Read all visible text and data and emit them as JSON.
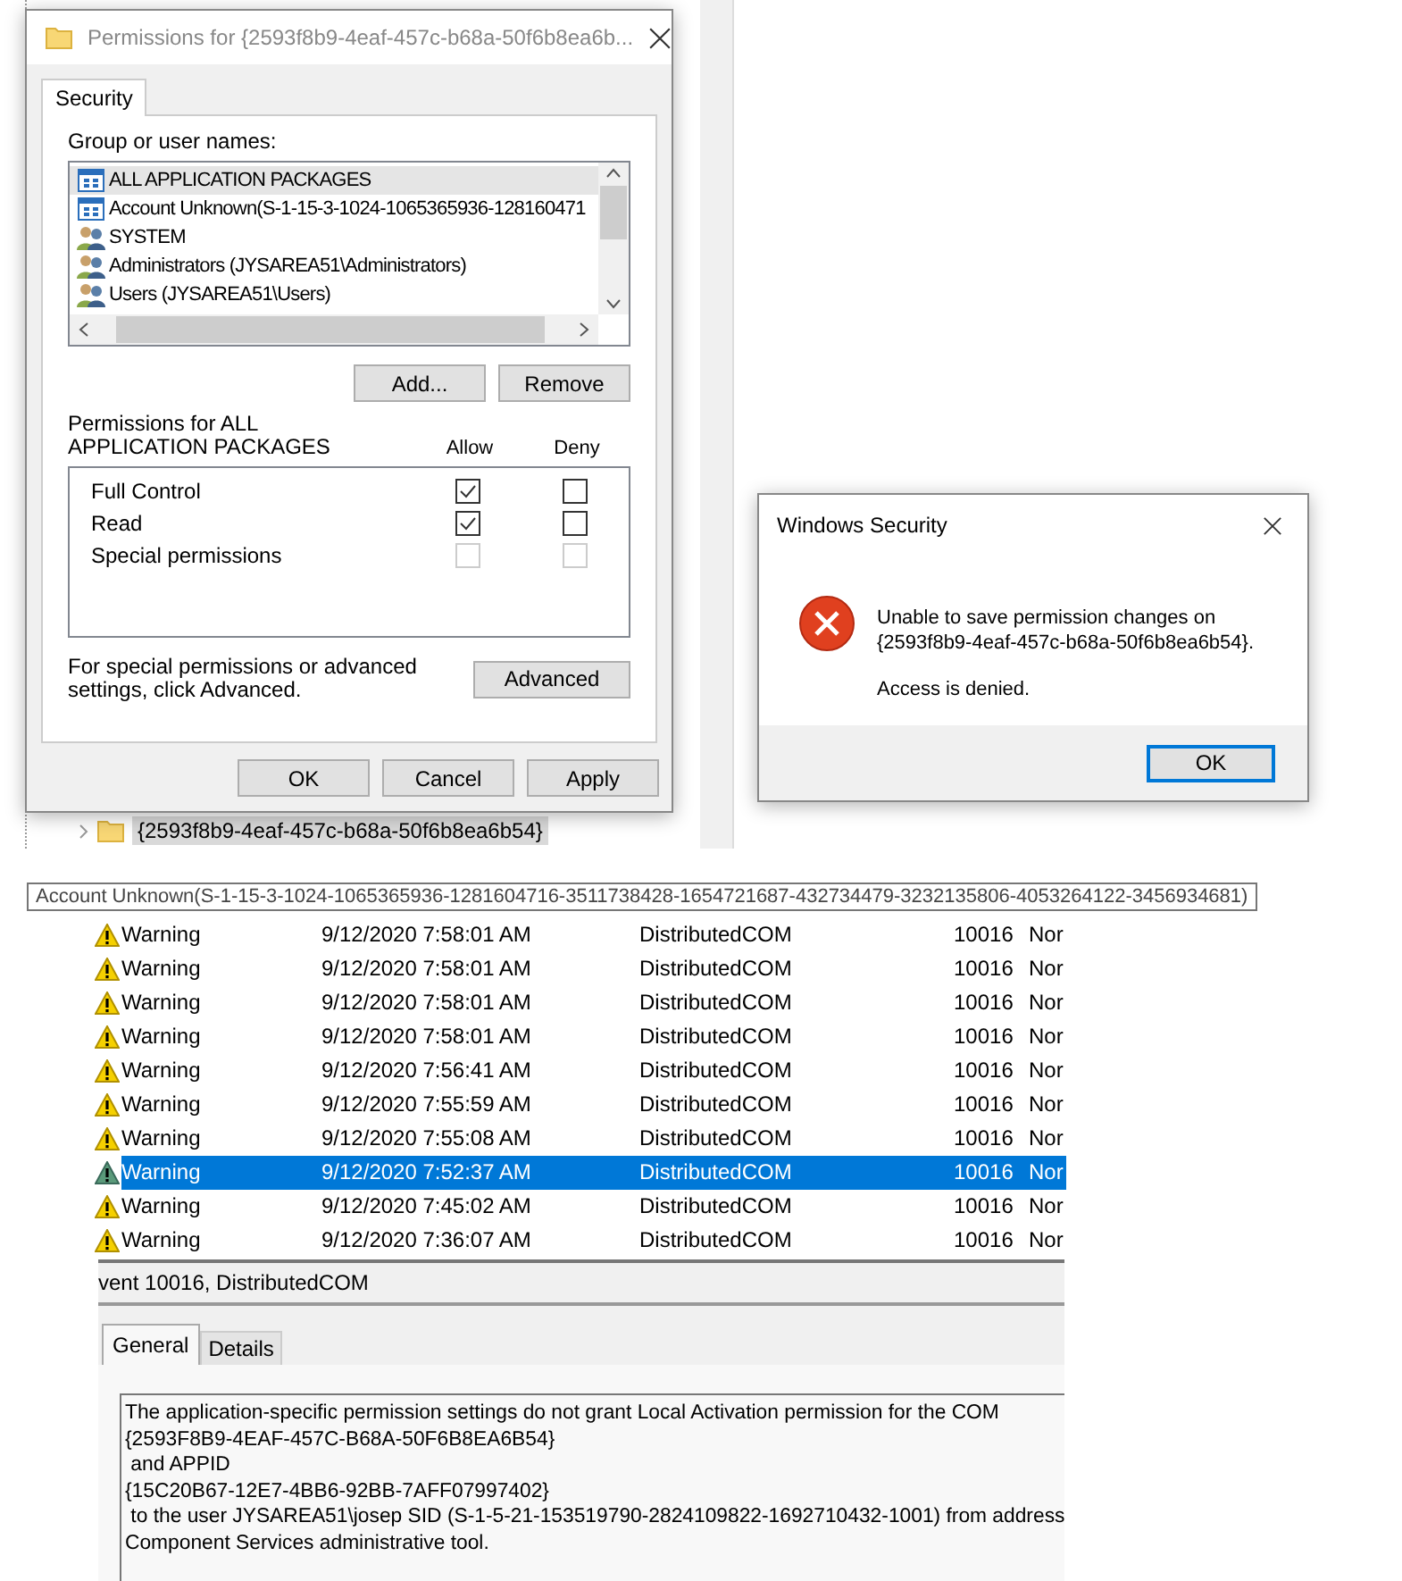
{
  "registry_tree": {
    "items": [
      {
        "label": "{2593f8b9-4eaf-457c-b68a-50f6b8ea6b54}",
        "selected": true
      }
    ]
  },
  "permissions_dialog": {
    "title": "Permissions for {2593f8b9-4eaf-457c-b68a-50f6b8ea6b...",
    "tabs": [
      {
        "label": "Security",
        "selected": true
      }
    ],
    "group_label": "Group or user names:",
    "principals": [
      {
        "name": "ALL APPLICATION PACKAGES",
        "kind": "package",
        "selected": true
      },
      {
        "name": "Account Unknown(S-1-15-3-1024-1065365936-128160471",
        "kind": "package",
        "selected": false
      },
      {
        "name": "SYSTEM",
        "kind": "group",
        "selected": false
      },
      {
        "name": "Administrators (JYSAREA51\\Administrators)",
        "kind": "group",
        "selected": false
      },
      {
        "name": "Users (JYSAREA51\\Users)",
        "kind": "group",
        "selected": false
      }
    ],
    "add_button": "Add...",
    "remove_button": "Remove",
    "permissions_label": "Permissions for ALL APPLICATION PACKAGES",
    "allow_header": "Allow",
    "deny_header": "Deny",
    "permissions": [
      {
        "name": "Full Control",
        "allow": true,
        "deny": false,
        "disabled": false
      },
      {
        "name": "Read",
        "allow": true,
        "deny": false,
        "disabled": false
      },
      {
        "name": "Special permissions",
        "allow": false,
        "deny": false,
        "disabled": true
      }
    ],
    "advanced_hint": "For special permissions or advanced settings, click Advanced.",
    "advanced_button": "Advanced",
    "buttons": [
      "OK",
      "Cancel",
      "Apply"
    ]
  },
  "security_dialog": {
    "title": "Windows Security",
    "message": "Unable to save permission changes on {2593f8b9-4eaf-457c-b68a-50f6b8ea6b54}.",
    "detail": "Access is denied.",
    "button": "OK"
  },
  "account_tooltip": "Account Unknown(S-1-15-3-1024-1065365936-1281604716-3511738428-1654721687-432734479-3232135806-4053264122-3456934681)",
  "events": [
    {
      "level": "Warning",
      "date": "9/12/2020 7:58:01 AM",
      "source": "DistributedCOM",
      "event_id": "10016",
      "column_5": "Nor",
      "selected": false
    },
    {
      "level": "Warning",
      "date": "9/12/2020 7:58:01 AM",
      "source": "DistributedCOM",
      "event_id": "10016",
      "column_5": "Nor",
      "selected": false
    },
    {
      "level": "Warning",
      "date": "9/12/2020 7:58:01 AM",
      "source": "DistributedCOM",
      "event_id": "10016",
      "column_5": "Nor",
      "selected": false
    },
    {
      "level": "Warning",
      "date": "9/12/2020 7:58:01 AM",
      "source": "DistributedCOM",
      "event_id": "10016",
      "column_5": "Nor",
      "selected": false
    },
    {
      "level": "Warning",
      "date": "9/12/2020 7:56:41 AM",
      "source": "DistributedCOM",
      "event_id": "10016",
      "column_5": "Nor",
      "selected": false
    },
    {
      "level": "Warning",
      "date": "9/12/2020 7:55:59 AM",
      "source": "DistributedCOM",
      "event_id": "10016",
      "column_5": "Nor",
      "selected": false
    },
    {
      "level": "Warning",
      "date": "9/12/2020 7:55:08 AM",
      "source": "DistributedCOM",
      "event_id": "10016",
      "column_5": "Nor",
      "selected": false
    },
    {
      "level": "Warning",
      "date": "9/12/2020 7:52:37 AM",
      "source": "DistributedCOM",
      "event_id": "10016",
      "column_5": "Nor",
      "selected": true
    },
    {
      "level": "Warning",
      "date": "9/12/2020 7:45:02 AM",
      "source": "DistributedCOM",
      "event_id": "10016",
      "column_5": "Nor",
      "selected": false
    },
    {
      "level": "Warning",
      "date": "9/12/2020 7:36:07 AM",
      "source": "DistributedCOM",
      "event_id": "10016",
      "column_5": "Nor",
      "selected": false
    }
  ],
  "event_details": {
    "title": "vent 10016, DistributedCOM",
    "tabs": [
      {
        "label": "General",
        "selected": true
      },
      {
        "label": "Details",
        "selected": false
      }
    ],
    "description": [
      "The application-specific permission settings do not grant Local Activation permission for the COM",
      "{2593F8B9-4EAF-457C-B68A-50F6B8EA6B54}",
      " and APPID",
      "{15C20B67-12E7-4BB6-92BB-7AFF07997402}",
      " to the user JYSAREA51\\josep SID (S-1-5-21-153519790-2824109822-1692710432-1001) from address",
      "Component Services administrative tool."
    ]
  }
}
